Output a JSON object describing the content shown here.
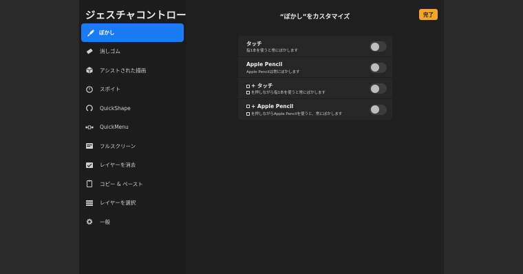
{
  "sidebar": {
    "title": "ジェスチャコントロール",
    "items": [
      {
        "label": "ぼかし",
        "icon": "brush-icon",
        "active": true
      },
      {
        "label": "消しゴム",
        "icon": "eraser-icon"
      },
      {
        "label": "アシストされた描画",
        "icon": "cube-icon"
      },
      {
        "label": "スポイト",
        "icon": "eyedropper-icon"
      },
      {
        "label": "QuickShape",
        "icon": "quickshape-icon"
      },
      {
        "label": "QuickMenu",
        "icon": "quickmenu-icon"
      },
      {
        "label": "フルスクリーン",
        "icon": "fullscreen-icon"
      },
      {
        "label": "レイヤーを消去",
        "icon": "clear-layer-icon"
      },
      {
        "label": "コピー & ペースト",
        "icon": "copy-paste-icon"
      },
      {
        "label": "レイヤーを選択",
        "icon": "layers-icon"
      },
      {
        "label": "一般",
        "icon": "gear-icon"
      }
    ]
  },
  "main": {
    "title": "“ぼかし”をカスタマイズ",
    "done_label": "完了",
    "settings": [
      {
        "title": "タッチ",
        "subtitle": "指1本を使うと常にぼかします",
        "title_square": false,
        "subtitle_square": false,
        "enabled": false
      },
      {
        "title": "Apple Pencil",
        "subtitle": "Apple Pencilは常にぼかします",
        "title_square": false,
        "subtitle_square": false,
        "enabled": false
      },
      {
        "title": "+ タッチ",
        "subtitle": "を押しながら指1本を使うと常にぼかします",
        "title_square": true,
        "subtitle_square": true,
        "enabled": false
      },
      {
        "title": "+ Apple Pencil",
        "subtitle": "を押しながらApple Pencilを使うと、常にぼかします",
        "title_square": true,
        "subtitle_square": true,
        "enabled": false
      }
    ]
  },
  "colors": {
    "accent": "#1a7cf5",
    "done_button": "#f5a623"
  }
}
